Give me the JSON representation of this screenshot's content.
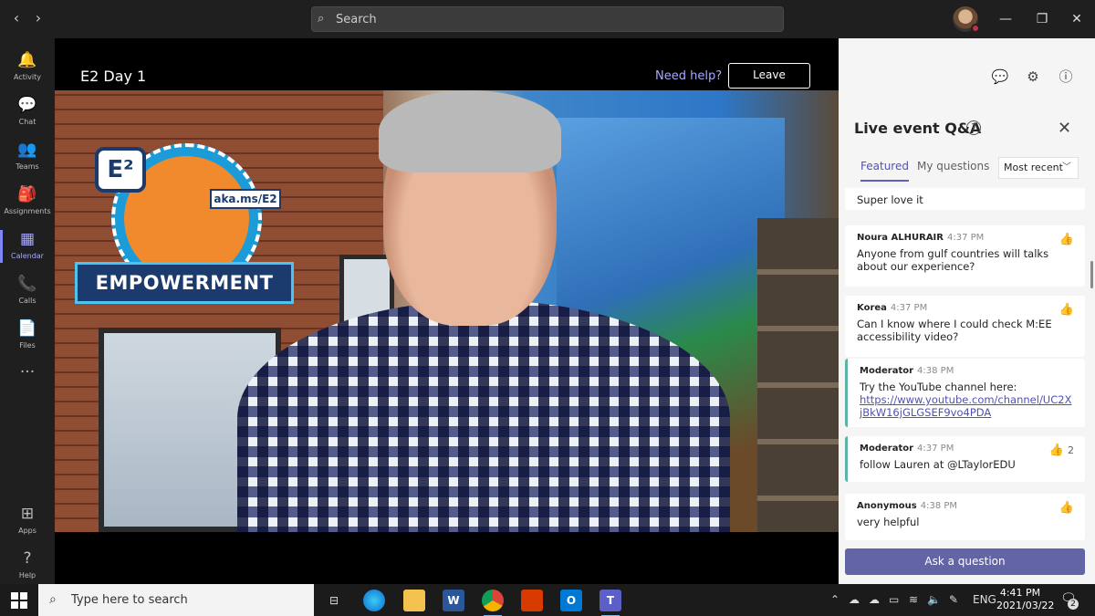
{
  "titlebar": {
    "search_placeholder": "Search",
    "back_icon": "chevron-left-icon",
    "forward_icon": "chevron-right-icon",
    "minimize": "—",
    "maximize": "❐",
    "close": "✕"
  },
  "rail": {
    "items": [
      {
        "label": "Activity",
        "icon": "🔔"
      },
      {
        "label": "Chat",
        "icon": "💬"
      },
      {
        "label": "Teams",
        "icon": "👥"
      },
      {
        "label": "Assignments",
        "icon": "🎒"
      },
      {
        "label": "Calendar",
        "icon": "▦"
      },
      {
        "label": "Calls",
        "icon": "📞"
      },
      {
        "label": "Files",
        "icon": "📄"
      },
      {
        "label": "",
        "icon": "···"
      },
      {
        "label": "Apps",
        "icon": "⊞"
      },
      {
        "label": "Help",
        "icon": "?"
      }
    ]
  },
  "meeting": {
    "title": "E2 Day 1",
    "need_help": "Need help?",
    "leave": "Leave"
  },
  "badge": {
    "logo": "E²",
    "link": "aka.ms/E2",
    "banner": "EMPOWERMENT"
  },
  "panel": {
    "title": "Live event Q&A",
    "tabs": [
      "Featured",
      "My questions"
    ],
    "sort": "Most recent",
    "partial_text": "Super love it",
    "questions": [
      {
        "name": "Noura ALHURAIR",
        "time": "4:37 PM",
        "text": "Anyone from gulf countries will talks about our experience?",
        "likes": ""
      },
      {
        "name": "Korea",
        "time": "4:37 PM",
        "text": "Can I know where I could check M:EE accessibility video?",
        "likes": ""
      },
      {
        "name": "Moderator",
        "time": "4:38 PM",
        "text": "Try the YouTube channel here:",
        "link": "https://www.youtube.com/channel/UC2XjBkW16jGLGSEF9vo4PDA",
        "likes": ""
      },
      {
        "name": "Moderator",
        "time": "4:37 PM",
        "text": "follow Lauren at @LTaylorEDU",
        "likes": "2"
      },
      {
        "name": "Anonymous",
        "time": "4:38 PM",
        "text": "very helpful",
        "likes": ""
      }
    ],
    "ask": "Ask a question"
  },
  "taskbar": {
    "search_placeholder": "Type here to search",
    "lang": "ENG",
    "time": "4:41 PM",
    "date": "2021/03/22",
    "notifications": "2"
  }
}
